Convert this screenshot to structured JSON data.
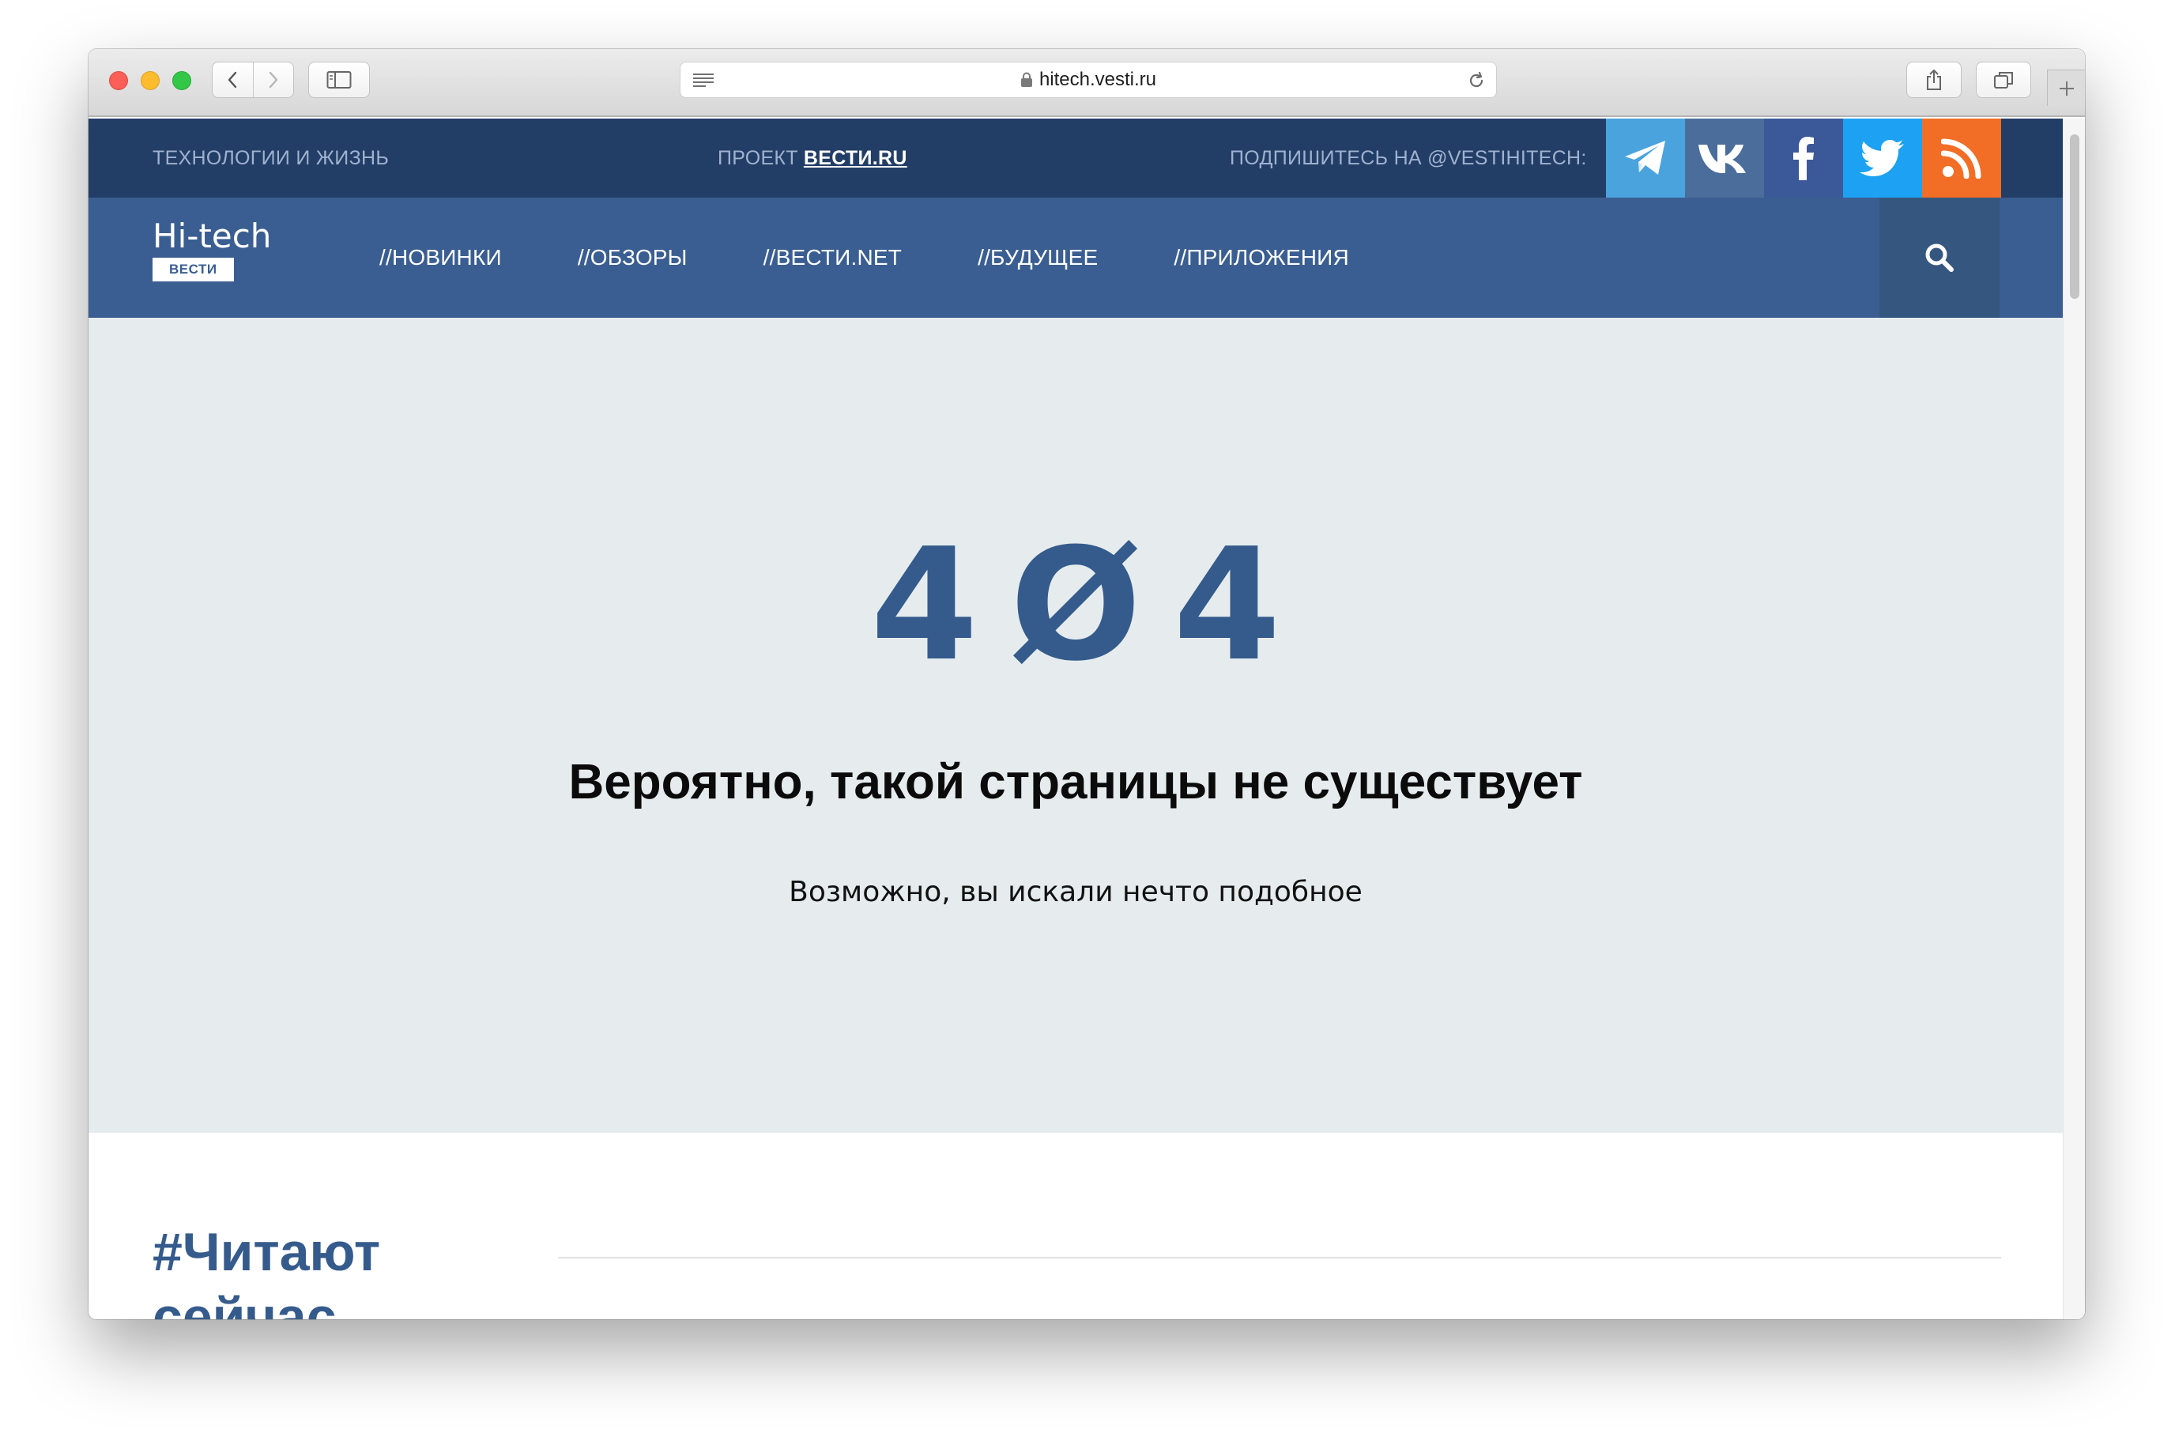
{
  "browser": {
    "url": "hitech.vesti.ru"
  },
  "topbar": {
    "tagline": "ТЕХНОЛОГИИ И ЖИЗНЬ",
    "project_prefix": "ПРОЕКТ",
    "project_link": "ВЕСТИ.RU",
    "subscribe": "ПОДПИШИТЕСЬ НА @VESTIHITECH:",
    "social": [
      {
        "name": "telegram-icon",
        "color": "#4aa3dc"
      },
      {
        "name": "vk-icon",
        "color": "#4a6d9b"
      },
      {
        "name": "facebook-icon",
        "color": "#3b5998"
      },
      {
        "name": "twitter-icon",
        "color": "#1da1f2"
      },
      {
        "name": "rss-icon",
        "color": "#f26d25"
      }
    ]
  },
  "nav": {
    "logo_name": "Hi-tech",
    "logo_badge": "ВЕСТИ",
    "items": [
      {
        "label": "//НОВИНКИ"
      },
      {
        "label": "//ОБЗОРЫ"
      },
      {
        "label": "//ВЕСТИ.NET"
      },
      {
        "label": "//БУДУЩЕЕ"
      },
      {
        "label": "//ПРИЛОЖЕНИЯ"
      }
    ],
    "search_icon": "search-icon"
  },
  "error": {
    "code": "4Ø4",
    "title": "Вероятно, такой страницы не существует",
    "subtitle": "Возможно, вы искали нечто подобное"
  },
  "reading_now": {
    "title": "#Читают сейчас"
  },
  "colors": {
    "topbar": "#233e66",
    "nav": "#3a5e91",
    "accent": "#355b8c",
    "hero_bg": "#e6ecee"
  }
}
